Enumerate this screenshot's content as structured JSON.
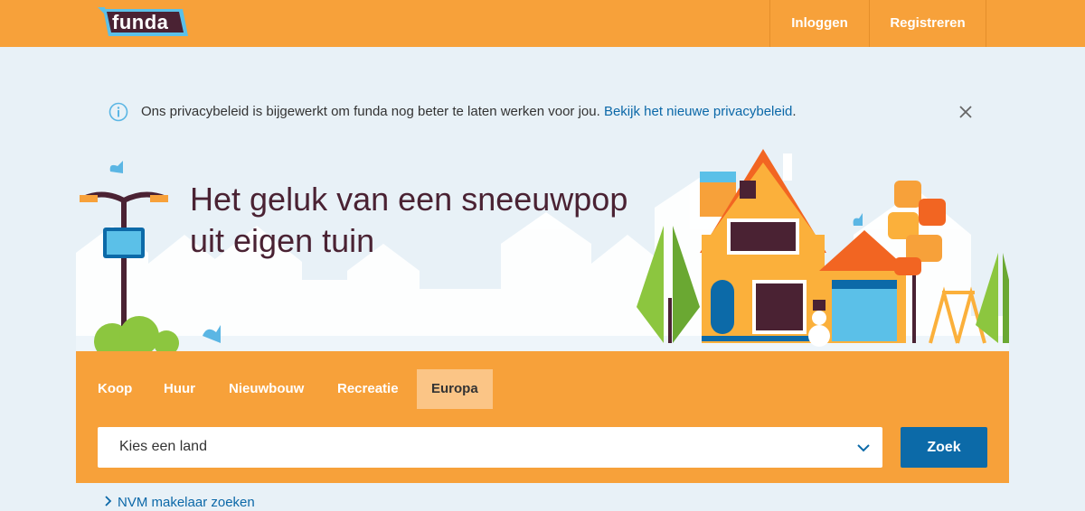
{
  "header": {
    "logo_text": "funda",
    "login_label": "Inloggen",
    "register_label": "Registreren"
  },
  "notice": {
    "text": "Ons privacybeleid is bijgewerkt om funda nog beter te laten werken voor jou.",
    "link_label": "Bekijk het nieuwe privacybeleid",
    "suffix": "."
  },
  "hero": {
    "title_line1": "Het geluk van een sneeuwpop",
    "title_line2": "uit eigen tuin"
  },
  "search": {
    "tabs": [
      {
        "label": "Koop",
        "active": false
      },
      {
        "label": "Huur",
        "active": false
      },
      {
        "label": "Nieuwbouw",
        "active": false
      },
      {
        "label": "Recreatie",
        "active": false
      },
      {
        "label": "Europa",
        "active": true
      }
    ],
    "select_value": "Kies een land",
    "button_label": "Zoek"
  },
  "links": {
    "nvm_label": "NVM makelaar zoeken"
  },
  "colors": {
    "brand_orange": "#f7a13a",
    "brand_blue": "#0c6aa8",
    "link_blue": "#0b68a8",
    "title_brown": "#4a2233"
  }
}
